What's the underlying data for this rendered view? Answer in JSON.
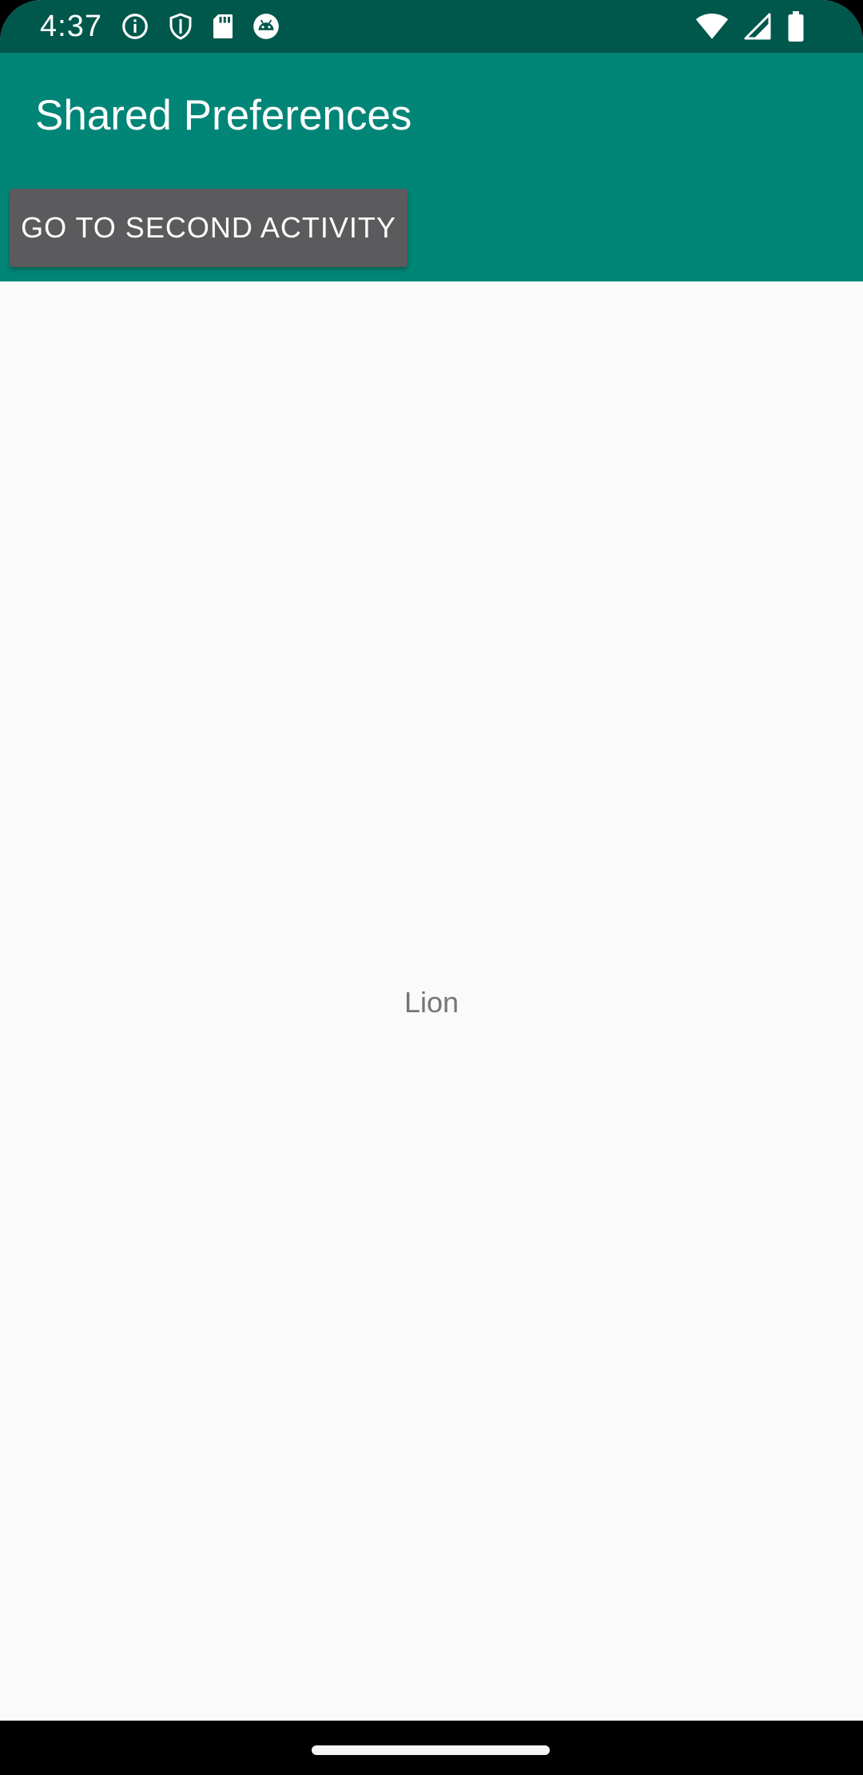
{
  "status_bar": {
    "time": "4:37",
    "background": "#00574b",
    "left_icons": [
      "info-icon",
      "shield-icon",
      "sd-card-icon",
      "android-icon"
    ],
    "right_icons": [
      "wifi-icon",
      "cellular-signal-icon",
      "battery-icon"
    ]
  },
  "app_bar": {
    "title": "Shared Preferences",
    "background": "#008577"
  },
  "actions": {
    "go_to_second_activity": "GO TO SECOND ACTIVITY",
    "button_color": "#5b5b5d"
  },
  "content": {
    "value_text": "Lion"
  }
}
